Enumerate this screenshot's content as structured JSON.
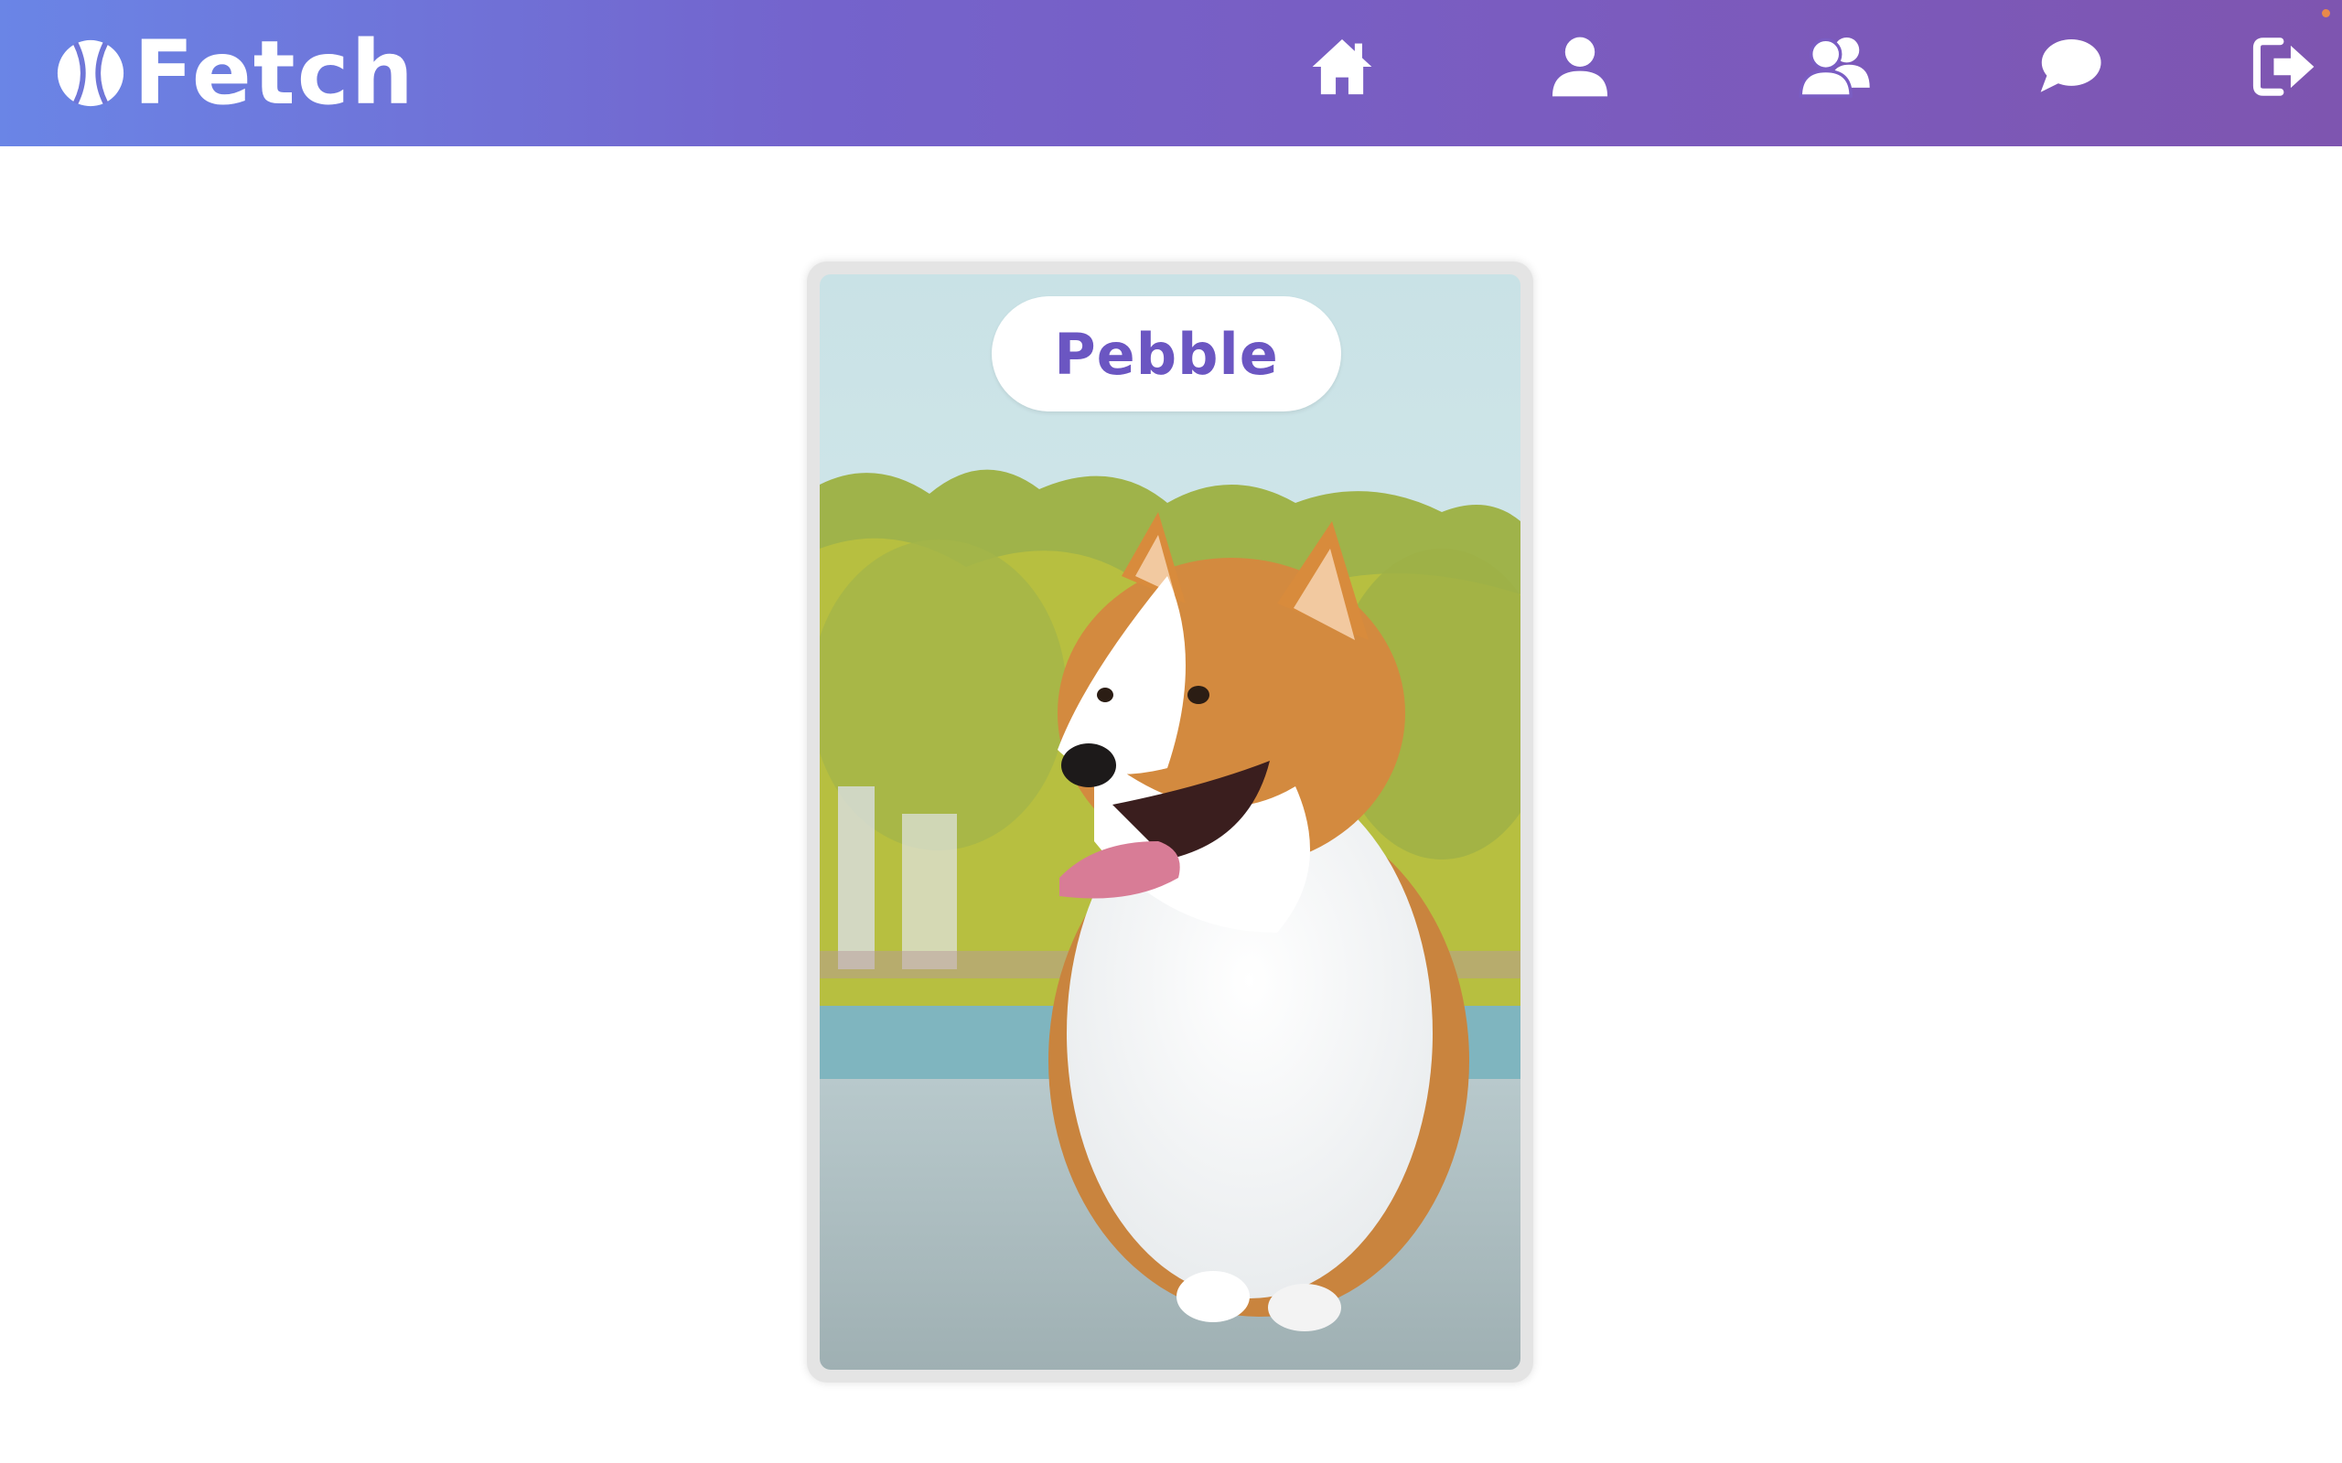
{
  "app": {
    "brand": "Fetch"
  },
  "nav": {
    "items": [
      {
        "icon": "home-icon"
      },
      {
        "icon": "user-icon"
      },
      {
        "icon": "users-icon"
      },
      {
        "icon": "chat-icon"
      },
      {
        "icon": "logout-icon"
      }
    ]
  },
  "card": {
    "name": "Pebble"
  },
  "colors": {
    "header_gradient_start": "#6a85e6",
    "header_gradient_end": "#7e55b0",
    "name_text": "#6b56c2"
  }
}
